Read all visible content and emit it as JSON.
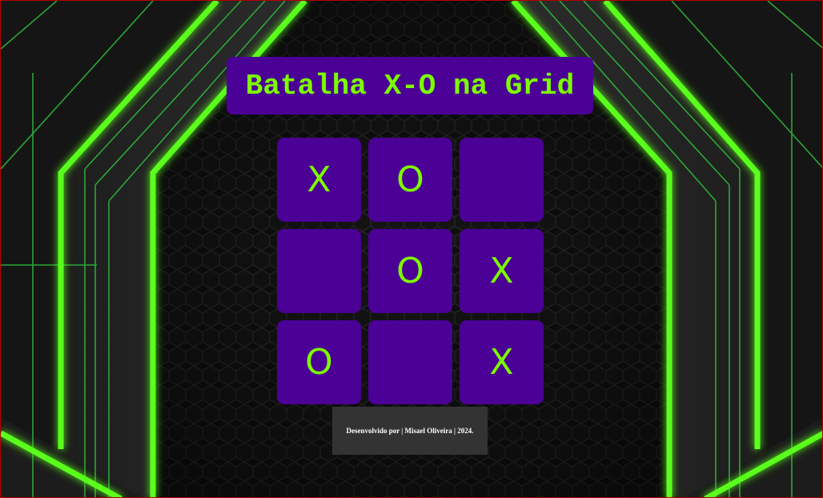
{
  "title": "Batalha X-O na Grid",
  "board": {
    "cells": [
      "X",
      "O",
      "",
      "",
      "O",
      "X",
      "O",
      "",
      "X"
    ]
  },
  "footer": {
    "text": "Desenvolvido por | Misael Oliveira | 2024."
  },
  "colors": {
    "accent": "#7cfc00",
    "cell_bg": "#4b0096",
    "footer_bg": "#333333",
    "background": "#111111"
  }
}
